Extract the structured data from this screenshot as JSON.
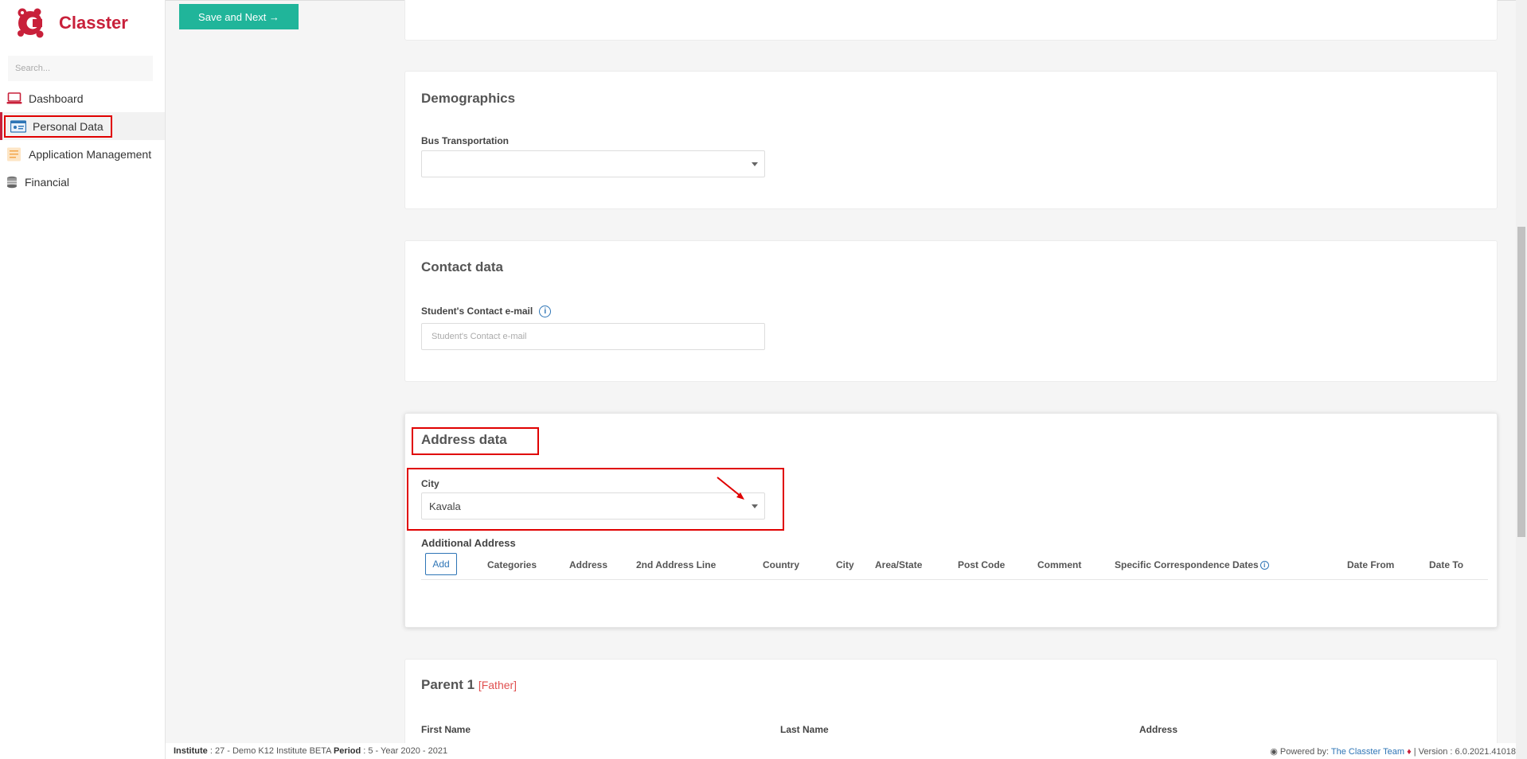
{
  "app": {
    "brand": "Classter",
    "brand_color": "#c8203a",
    "accent": "#20b59a"
  },
  "sidebar": {
    "search_placeholder": "Search...",
    "items": [
      {
        "label": "Dashboard",
        "icon": "laptop-icon",
        "active": false
      },
      {
        "label": "Personal Data",
        "icon": "id-card-icon",
        "active": true
      },
      {
        "label": "Application Management",
        "icon": "form-icon",
        "active": false
      },
      {
        "label": "Financial",
        "icon": "coins-icon",
        "active": false
      }
    ]
  },
  "toolbar": {
    "save_next_label": "Save and Next →"
  },
  "demographics": {
    "title": "Demographics",
    "bus_label": "Bus Transportation",
    "bus_value": ""
  },
  "contact": {
    "title": "Contact data",
    "email_label": "Student's Contact e-mail",
    "email_placeholder": "Student's Contact e-mail",
    "email_value": ""
  },
  "address": {
    "title": "Address data",
    "city_label": "City",
    "city_value": "Kavala",
    "additional_label": "Additional Address",
    "add_label": "Add",
    "columns": [
      "Categories",
      "Address",
      "2nd Address Line",
      "Country",
      "City",
      "Area/State",
      "Post Code",
      "Comment",
      "Specific Correspondence Dates",
      "Date From",
      "Date To"
    ]
  },
  "parent1": {
    "title": "Parent 1",
    "relation": "[Father]",
    "first_name_label": "First Name",
    "last_name_label": "Last Name",
    "address_label": "Address"
  },
  "footer": {
    "institute_key": "Institute",
    "institute_value": ": 27 - Demo K12 Institute BETA",
    "period_key": "Period",
    "period_value": ": 5 - Year 2020 - 2021",
    "powered_by": "Powered by:",
    "team": "The Classter Team",
    "version": "| Version : 6.0.2021.41018"
  }
}
